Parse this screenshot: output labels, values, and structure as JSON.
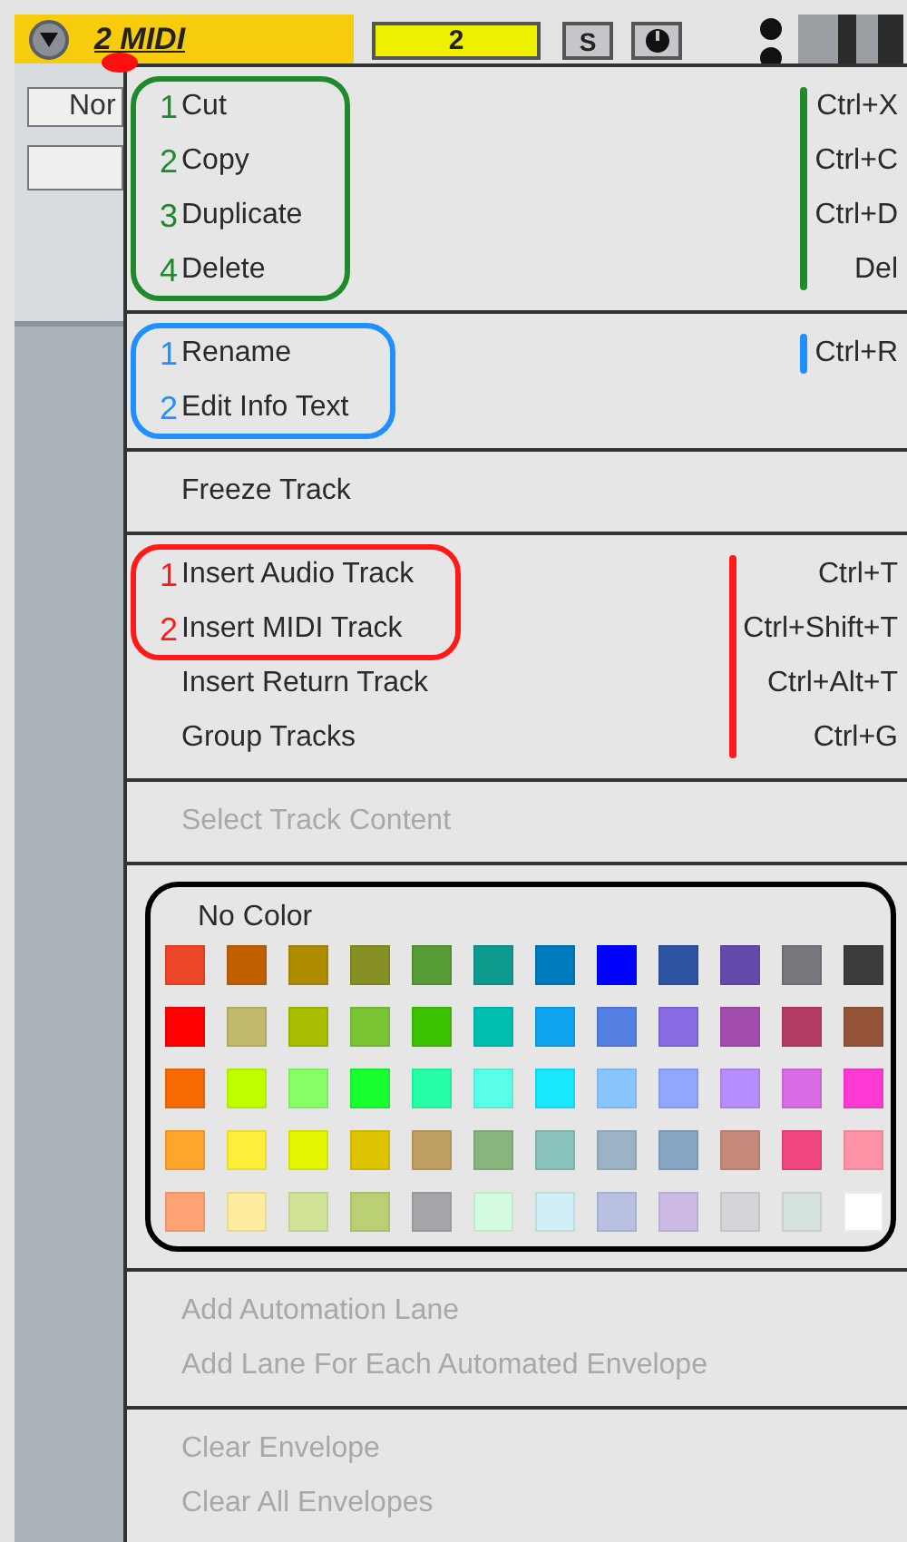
{
  "track_header": {
    "name": "2 MIDI",
    "clip_slot": "2",
    "solo_button": "S",
    "monitor_field": "Nor"
  },
  "menu": {
    "sections": [
      {
        "kind": "items",
        "annotation": {
          "color": "#1f8a2b"
        },
        "items": [
          {
            "label": "Cut",
            "shortcut": "Ctrl+X",
            "disabled": false,
            "marker": "1"
          },
          {
            "label": "Copy",
            "shortcut": "Ctrl+C",
            "disabled": false,
            "marker": "2"
          },
          {
            "label": "Duplicate",
            "shortcut": "Ctrl+D",
            "disabled": false,
            "marker": "3"
          },
          {
            "label": "Delete",
            "shortcut": "Del",
            "disabled": false,
            "marker": "4"
          }
        ]
      },
      {
        "kind": "items",
        "annotation": {
          "color": "#1e90ff"
        },
        "items": [
          {
            "label": "Rename",
            "shortcut": "Ctrl+R",
            "disabled": false,
            "marker": "1"
          },
          {
            "label": "Edit Info Text",
            "disabled": false,
            "marker": "2"
          }
        ]
      },
      {
        "kind": "items",
        "items": [
          {
            "label": "Freeze Track",
            "disabled": false
          }
        ]
      },
      {
        "kind": "items",
        "annotation": {
          "color": "#ff1a1a"
        },
        "items": [
          {
            "label": "Insert Audio Track",
            "shortcut": "Ctrl+T",
            "disabled": false,
            "marker": "1"
          },
          {
            "label": "Insert MIDI Track",
            "shortcut": "Ctrl+Shift+T",
            "disabled": false,
            "marker": "2"
          },
          {
            "label": "Insert Return Track",
            "shortcut": "Ctrl+Alt+T",
            "disabled": false
          },
          {
            "label": "Group Tracks",
            "shortcut": "Ctrl+G",
            "disabled": false
          }
        ]
      },
      {
        "kind": "items",
        "items": [
          {
            "label": "Select Track Content",
            "disabled": true
          }
        ]
      },
      {
        "kind": "palette",
        "label": "No Color",
        "annotation": {
          "color": "#000000"
        },
        "swatches": [
          {
            "color": "#ee4628"
          },
          {
            "color": "#bf5f00"
          },
          {
            "color": "#b08c00"
          },
          {
            "color": "#879022"
          },
          {
            "color": "#559c35"
          },
          {
            "color": "#0c9a8c"
          },
          {
            "color": "#007bbd"
          },
          {
            "color": "#0000ff"
          },
          {
            "color": "#2f53a3"
          },
          {
            "color": "#6449ad"
          },
          {
            "color": "#76777c"
          },
          {
            "color": "#3c3c3c"
          },
          {
            "color": "#ff0000"
          },
          {
            "color": "#c1b96b"
          },
          {
            "color": "#a7bd00"
          },
          {
            "color": "#7ac434"
          },
          {
            "color": "#3dc300"
          },
          {
            "color": "#00bfaf"
          },
          {
            "color": "#10a4ee"
          },
          {
            "color": "#5480e4"
          },
          {
            "color": "#886ce4"
          },
          {
            "color": "#a24cad"
          },
          {
            "color": "#b43c66"
          },
          {
            "color": "#96553a"
          },
          {
            "color": "#f76a00"
          },
          {
            "color": "#bfff00"
          },
          {
            "color": "#87ff67"
          },
          {
            "color": "#1aff2f"
          },
          {
            "color": "#25ffa8"
          },
          {
            "color": "#5cffe8"
          },
          {
            "color": "#19e9ff"
          },
          {
            "color": "#8bc5ff"
          },
          {
            "color": "#92a7ff"
          },
          {
            "color": "#b88dff"
          },
          {
            "color": "#d86ce4"
          },
          {
            "color": "#ff39d4"
          },
          {
            "color": "#ffa52c"
          },
          {
            "color": "#ffef3a"
          },
          {
            "color": "#e4f700"
          },
          {
            "color": "#ddc300"
          },
          {
            "color": "#bf9f63"
          },
          {
            "color": "#88b47e"
          },
          {
            "color": "#89c2bb"
          },
          {
            "color": "#9bb3c4"
          },
          {
            "color": "#85a5c2"
          },
          {
            "color": "#c5897b"
          },
          {
            "color": "#f0457e"
          },
          {
            "color": "#ff93a7"
          },
          {
            "color": "#ffa374"
          },
          {
            "color": "#ffec9e"
          },
          {
            "color": "#d2e498"
          },
          {
            "color": "#bad074"
          },
          {
            "color": "#a5a6a9"
          },
          {
            "color": "#d5fce0"
          },
          {
            "color": "#d0eff7"
          },
          {
            "color": "#b8c1e2"
          },
          {
            "color": "#cdbbe4"
          },
          {
            "color": "#d4d5d9"
          },
          {
            "color": "#d6e2e0"
          },
          {
            "color": "#ffffff"
          }
        ]
      },
      {
        "kind": "items",
        "items": [
          {
            "label": "Add Automation Lane",
            "disabled": true
          },
          {
            "label": "Add Lane For Each Automated Envelope",
            "disabled": true
          }
        ]
      },
      {
        "kind": "items",
        "items": [
          {
            "label": "Clear Envelope",
            "disabled": true
          },
          {
            "label": "Clear All Envelopes",
            "disabled": true
          }
        ]
      }
    ]
  }
}
